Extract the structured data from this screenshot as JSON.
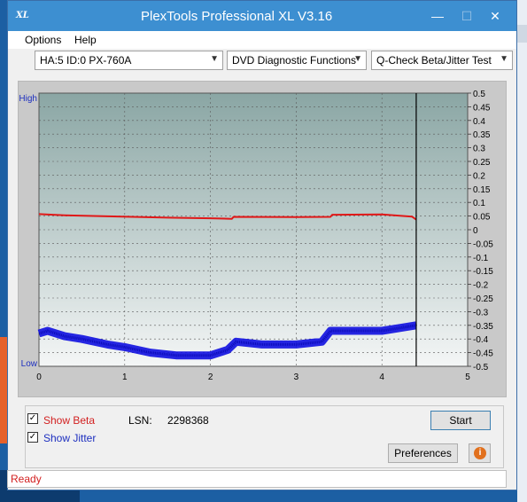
{
  "window": {
    "title": "PlexTools Professional XL V3.16",
    "icon_text": "XL",
    "controls": {
      "minimize": "—",
      "maximize": "☐",
      "close": "✕"
    }
  },
  "menu": {
    "options": "Options",
    "help": "Help"
  },
  "toolbar": {
    "drive": "HA:5 ID:0  PX-760A",
    "function": "DVD Diagnostic Functions",
    "test": "Q-Check Beta/Jitter Test"
  },
  "chart_data": {
    "type": "line",
    "left_axis": {
      "high": "High",
      "low": "Low"
    },
    "x_ticks": [
      "0",
      "1",
      "2",
      "3",
      "4",
      "5"
    ],
    "xlim": [
      0,
      5
    ],
    "ylim": [
      -0.5,
      0.5
    ],
    "y_ticks": [
      "0.5",
      "0.45",
      "0.4",
      "0.35",
      "0.3",
      "0.25",
      "0.2",
      "0.15",
      "0.1",
      "0.05",
      "0",
      "-0.05",
      "-0.1",
      "-0.15",
      "-0.2",
      "-0.25",
      "-0.3",
      "-0.35",
      "-0.4",
      "-0.45",
      "-0.5"
    ],
    "end_marker_x": 4.4,
    "grid": true,
    "series": [
      {
        "color": "#e01818",
        "x": [
          0,
          0.3,
          0.8,
          1.5,
          2.0,
          2.25,
          2.27,
          3.0,
          3.4,
          3.42,
          4.0,
          4.35,
          4.4
        ],
        "y": [
          0.057,
          0.053,
          0.049,
          0.044,
          0.042,
          0.04,
          0.047,
          0.046,
          0.047,
          0.055,
          0.056,
          0.048,
          0.037
        ]
      },
      {
        "color": "#1010e0",
        "x": [
          0,
          0.1,
          0.3,
          0.5,
          0.8,
          1.0,
          1.3,
          1.6,
          2.0,
          2.2,
          2.3,
          2.6,
          3.0,
          3.3,
          3.4,
          3.6,
          4.0,
          4.2,
          4.4
        ],
        "y": [
          -0.38,
          -0.37,
          -0.39,
          -0.4,
          -0.42,
          -0.43,
          -0.45,
          -0.46,
          -0.46,
          -0.44,
          -0.41,
          -0.42,
          -0.42,
          -0.41,
          -0.37,
          -0.37,
          -0.37,
          -0.36,
          -0.35
        ]
      }
    ]
  },
  "controls": {
    "show_beta": "Show Beta",
    "show_jitter": "Show Jitter",
    "lsn_label": "LSN:",
    "lsn_value": "2298368",
    "start": "Start",
    "preferences": "Preferences",
    "info_icon": "i"
  },
  "status": {
    "text": "Ready"
  }
}
